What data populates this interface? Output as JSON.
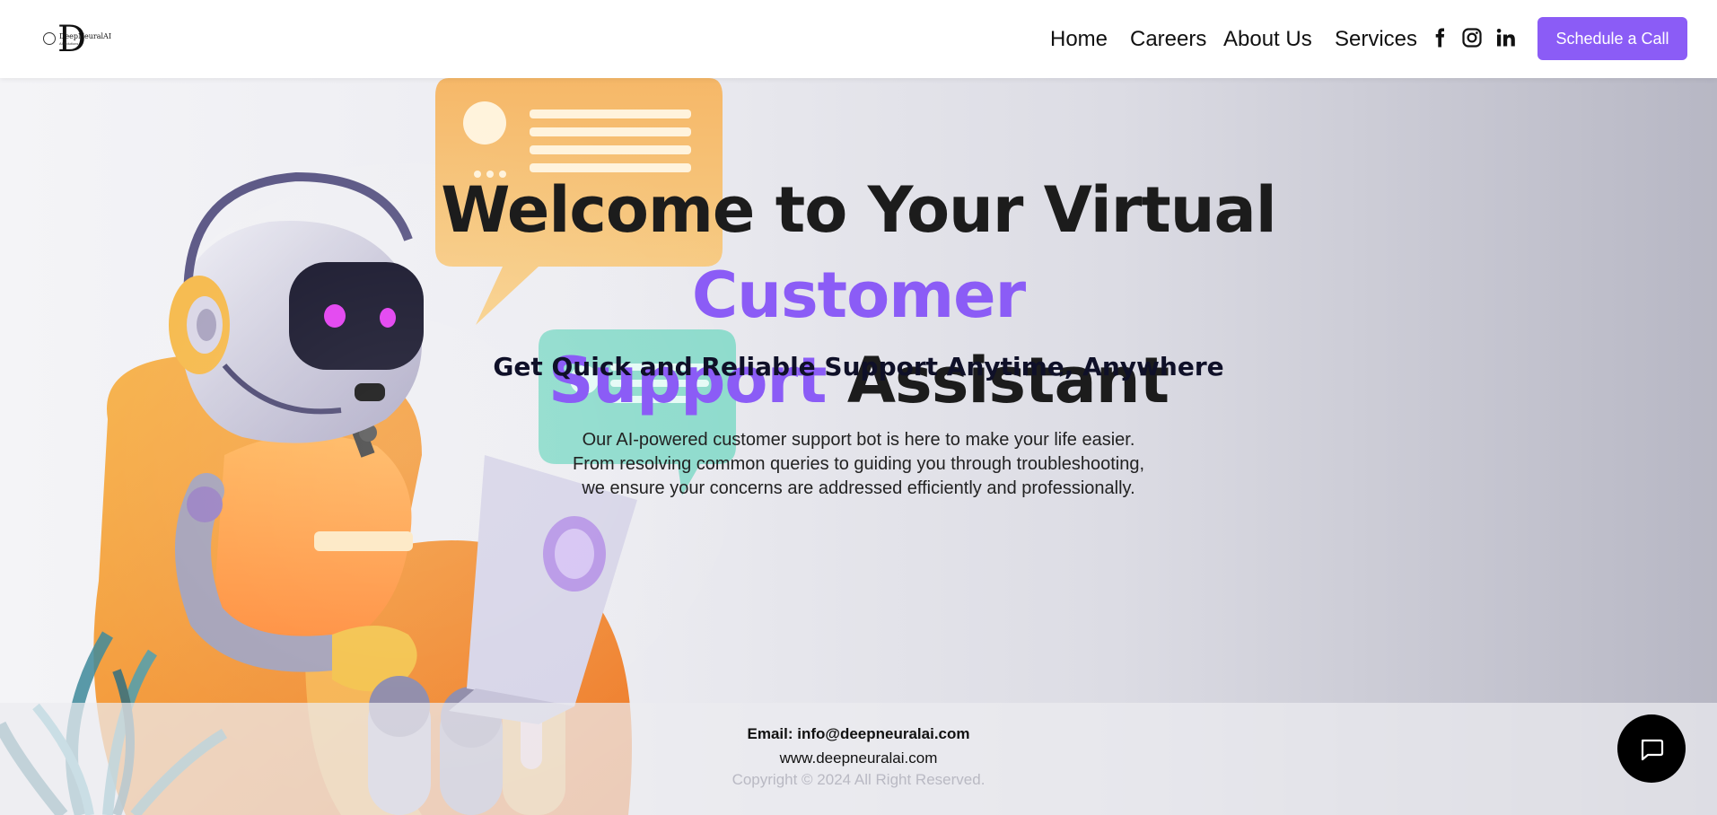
{
  "header": {
    "logo": {
      "brand": "DeepNeuralAI",
      "tagline": "AI Solutions"
    },
    "nav": [
      {
        "label": "Home"
      },
      {
        "label": "Careers"
      },
      {
        "label": "About Us"
      },
      {
        "label": "Services"
      }
    ],
    "social_icons": [
      "facebook-icon",
      "instagram-icon",
      "linkedin-icon"
    ],
    "cta_label": "Schedule a Call"
  },
  "hero": {
    "headline_parts": {
      "part1": "Welcome to Your Virtual ",
      "accent1": "Customer",
      "accent2": "Support",
      "part2": " Assistant"
    },
    "subheading": "Get Quick and Reliable Support Anytime, Anywhere",
    "description": [
      "Our AI-powered customer support bot is here to make your life easier.",
      "From resolving common queries to guiding you through troubleshooting,",
      "we ensure your concerns are addressed efficiently and professionally."
    ]
  },
  "footer": {
    "email": "Email: info@deepneuralai.com",
    "website": "www.deepneuralai.com",
    "copyright": "Copyright © 2024 All Right Reserved."
  },
  "chat_icon": "chat-bubble-icon",
  "colors": {
    "accent": "#8b5cf6",
    "text_dark": "#1c1c1c",
    "chat_button": "#000000"
  }
}
